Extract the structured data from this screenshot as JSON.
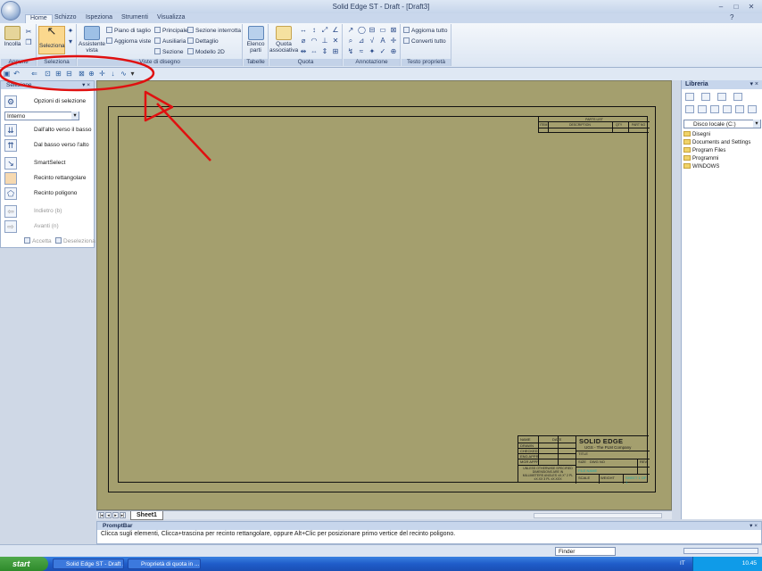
{
  "window": {
    "title": "Solid Edge ST - Draft - [Draft3]"
  },
  "tabs": [
    "Home",
    "Schizzo",
    "Ispeziona",
    "Strumenti",
    "Visualizza"
  ],
  "ribbon": {
    "appunti": {
      "label": "Appunti",
      "incolla": "Incolla"
    },
    "seleziona": {
      "label": "Seleziona",
      "button": "Seleziona"
    },
    "viste": {
      "label": "Viste di disegno",
      "assistente": "Assistente\nvista",
      "piano": "Piano di taglio",
      "aggiorna": "Aggiorna viste",
      "principale": "Principale",
      "ausiliaria": "Ausiliaria",
      "sezione": "Sezione",
      "sezione_interrotta": "Sezione interrotta",
      "dettaglio": "Dettaglio",
      "modello2d": "Modello 2D"
    },
    "tabelle": {
      "label": "Tabelle",
      "elenco": "Elenco\nparti"
    },
    "quota": {
      "label": "Quota",
      "associativa": "Quota\nassociativa"
    },
    "annotazione": {
      "label": "Annotazione"
    },
    "testo": {
      "label": "Testo proprietà",
      "aggiorna_tutto": "Aggiorna tutto",
      "converti_tutto": "Converti tutto"
    }
  },
  "left_panel": {
    "title": "Selezione",
    "opzioni": "Opzioni di selezione",
    "mode": "Interno",
    "items": [
      "Dall'alto verso il basso",
      "Dal basso verso l'alto",
      "SmartSelect",
      "Recinto rettangolare",
      "Recinto poligono",
      "Indietro (b)",
      "Avanti (n)"
    ],
    "accetta": "Accetta",
    "deseleziona": "Deseleziona"
  },
  "drawing": {
    "parts_title": "PARTS LIST",
    "parts_cols": [
      "ITEM",
      "DESCRIPTION",
      "QTY",
      "PART NO"
    ],
    "company": "SOLID EDGE",
    "subtitle": "UGS - The PLM Company",
    "tb_labels": [
      "NAME",
      "DATE",
      "DRAWN",
      "CHECKED",
      "ENG APPR",
      "MGR APPR"
    ],
    "tb_notes": "UNLESS OTHERWISE SPECIFIED DIMENSIONS ARE IN MILLIMETERS ANGLES ±X.X° 2 PL ±X.XX 3 PL ±X.XXX",
    "tb_right": [
      "TITLE",
      "SIZE",
      "DWG NO",
      "REV",
      "FILE NAME",
      "SCALE",
      "WEIGHT",
      "SHEET 1 OF 1"
    ]
  },
  "sheet_tab": "Sheet1",
  "right_panel": {
    "title": "Libreria",
    "drive": "Disco locale (C:)",
    "folders": [
      "Disegni",
      "Documents and Settings",
      "Program Files",
      "Programmi",
      "WINDOWS"
    ]
  },
  "promptbar": {
    "title": "PromptBar",
    "text": "Clicca sugli elementi, Clicca+trascina per recinto rettangolare, oppure Alt+Clic per posizionare primo vertice del recinto poligono."
  },
  "status": {
    "finder": "Finder"
  },
  "taskbar": {
    "start": "start",
    "tasks": [
      "Solid Edge ST - Draft ...",
      "Proprietà di quota in ..."
    ],
    "clock": "10.45",
    "lang": "IT"
  },
  "colors": {
    "canvas": "#a49f6e",
    "annotation": "#e01010",
    "ribbon": "#dce6f3"
  }
}
